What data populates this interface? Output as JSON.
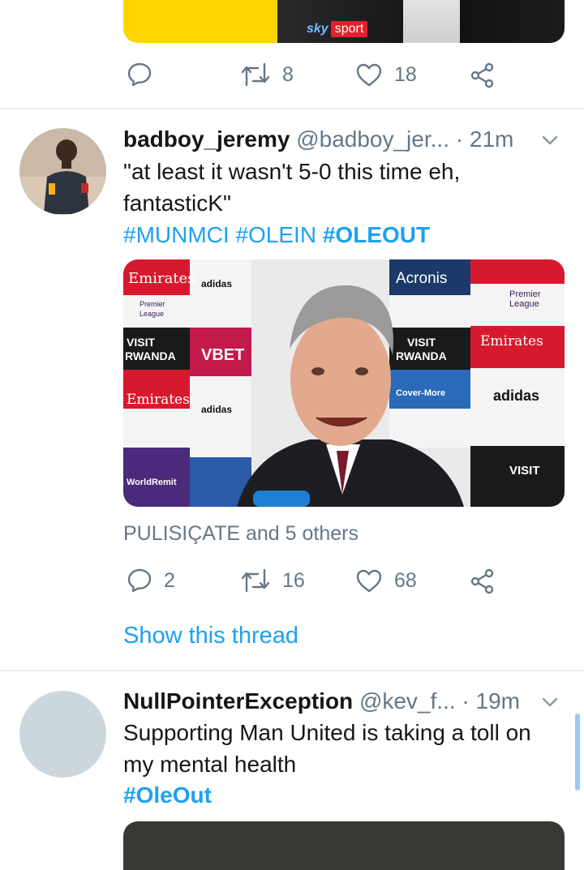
{
  "top_tweet": {
    "media_brand": "sky",
    "media_brand_tag": "sport",
    "actions": {
      "replies": "",
      "retweets": "8",
      "likes": "18"
    }
  },
  "tweet1": {
    "name": "badboy_jeremy",
    "handle": "@badboy_jer...",
    "time": "· 21m",
    "text_line1": "\"at least it wasn't 5-0 this time eh,",
    "text_line2": "fantasticK\"",
    "hashtags": [
      "#MUNMCI",
      "#OLEIN",
      "#OLEOUT"
    ],
    "media_boards": {
      "emirates": "Emirates",
      "adidas": "adidas",
      "premier": "Premier",
      "league": "League",
      "visit": "VISIT",
      "rwanda": "RWANDA",
      "vbet": "VBET",
      "acronis": "Acronis",
      "covermore": "Cover-More",
      "worldremit": "WorldRemit"
    },
    "liked_by": "PULISIÇATE and 5 others",
    "actions": {
      "replies": "2",
      "retweets": "16",
      "likes": "68"
    },
    "show_thread": "Show this thread"
  },
  "tweet2": {
    "name": "NullPointerException",
    "handle": "@kev_f...",
    "time": "· 19m",
    "text_line1": "Supporting Man United is taking a toll on",
    "text_line2": "my mental health",
    "hashtag": "#OleOut"
  },
  "colors": {
    "link": "#1da1f2",
    "muted": "#657786",
    "text": "#14171a",
    "divider": "#e6ecf0"
  },
  "icons": [
    "reply-icon",
    "retweet-icon",
    "like-icon",
    "share-icon",
    "caret-down-icon"
  ]
}
